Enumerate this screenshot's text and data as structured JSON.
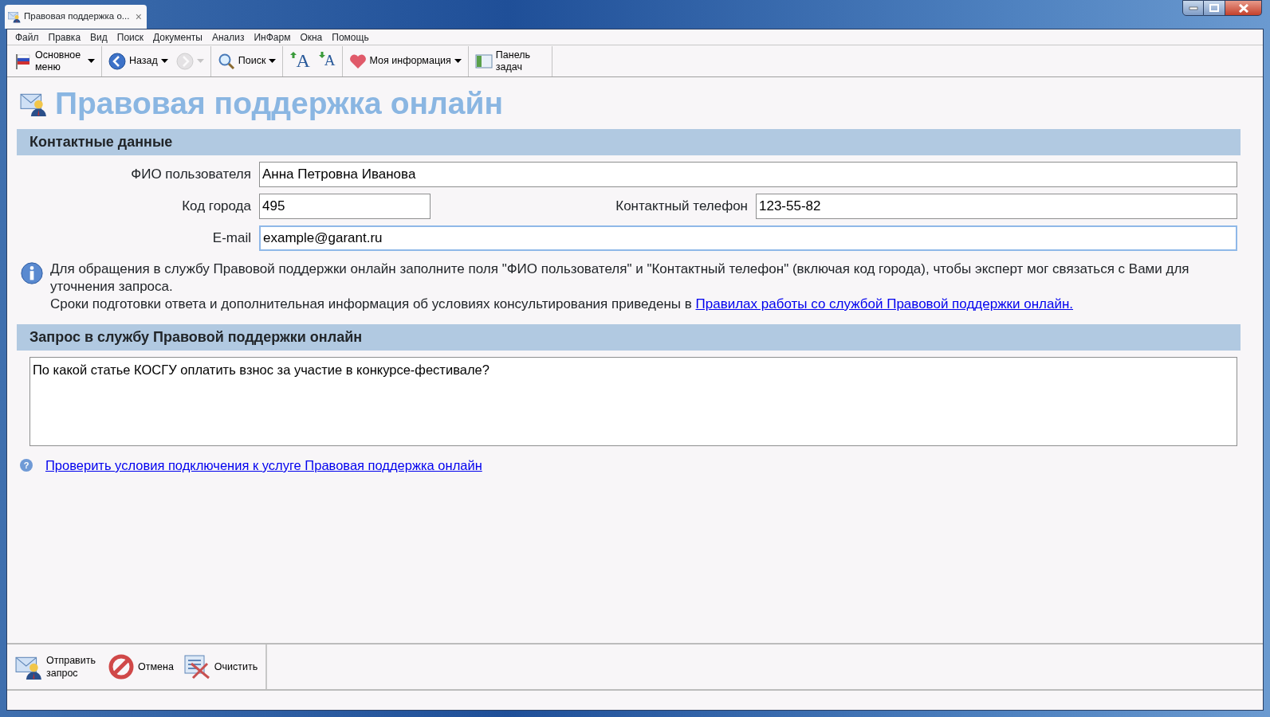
{
  "window": {
    "tab_title": "Правовая поддержка о...",
    "tab_close": "×"
  },
  "menu": [
    "Файл",
    "Правка",
    "Вид",
    "Поиск",
    "Документы",
    "Анализ",
    "ИнФарм",
    "Окна",
    "Помощь"
  ],
  "toolbar": [
    {
      "label": "Основное меню",
      "dropdown": true,
      "disabled": false,
      "separator_after": true
    },
    {
      "label": "Назад",
      "dropdown": true,
      "disabled": false,
      "separator_after": false
    },
    {
      "dropdown": true,
      "disabled": true,
      "separator_after": true
    },
    {
      "label": "Поиск",
      "dropdown": true,
      "disabled": false,
      "separator_after": true
    },
    {
      "glyph": "A",
      "dropdown": false,
      "disabled": false,
      "separator_after": false
    },
    {
      "glyph": "A",
      "dropdown": false,
      "disabled": false,
      "separator_after": true
    },
    {
      "label": "Моя информация",
      "dropdown": true,
      "disabled": false,
      "separator_after": true
    },
    {
      "label": "Панель задач",
      "dropdown": false,
      "disabled": false,
      "separator_after": true
    }
  ],
  "page_title": "Правовая поддержка онлайн",
  "contact": {
    "heading": "Контактные данные",
    "rows": [
      [
        {
          "label": "ФИО пользователя",
          "value": "Анна Петровна Иванова",
          "focused": false
        }
      ],
      [
        {
          "label": "Код города",
          "value": "495",
          "focused": false
        },
        {
          "label": "Контактный телефон",
          "value": "123-55-82",
          "focused": false
        }
      ],
      [
        {
          "label": "E-mail",
          "value": "example@garant.ru",
          "focused": true
        }
      ]
    ]
  },
  "info": {
    "text": "Для обращения в службу Правовой поддержки онлайн заполните поля \"ФИО пользователя\" и \"Контактный телефон\" (включая код города), чтобы эксперт мог связаться с Вами для уточнения запроса.",
    "note": "Сроки подготовки ответа и дополнительная информация об условиях консультирования приведены в ",
    "link": "Правилах работы со службой Правовой поддержки онлайн."
  },
  "request": {
    "heading": "Запрос в службу Правовой поддержки онлайн",
    "value": "По какой статье КОСГУ оплатить взнос за участие в конкурсе-фестивале?"
  },
  "check_icon": "?",
  "check_link": "Проверить условия подключения к услуге Правовая поддержка онлайн",
  "bottom_buttons": [
    "Отправить запрос",
    "Отмена",
    "Очистить"
  ]
}
